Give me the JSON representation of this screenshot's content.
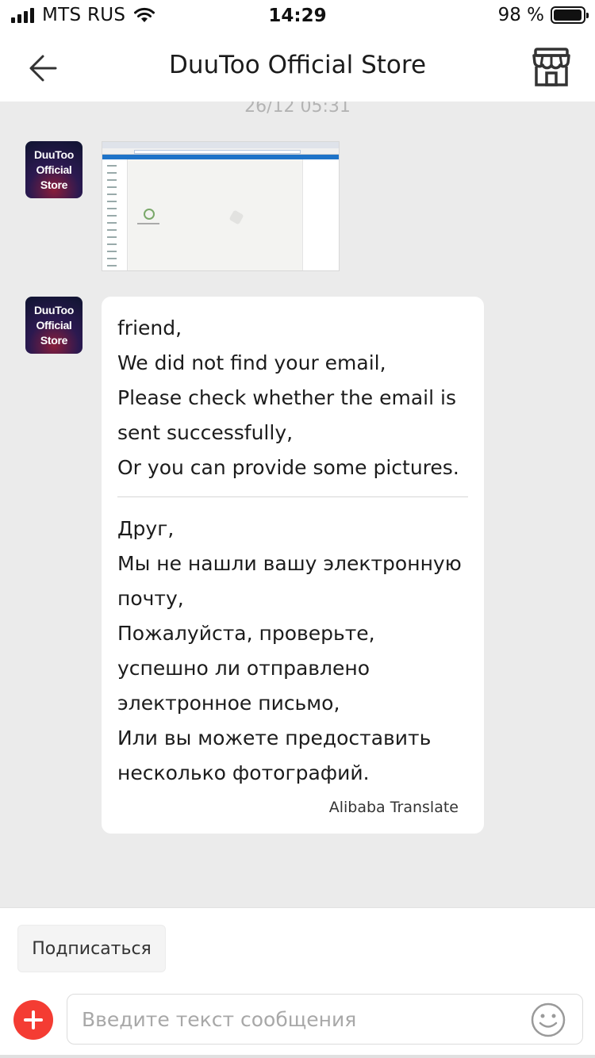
{
  "status_bar": {
    "carrier": "MTS RUS",
    "time": "14:29",
    "battery_percent": "98 %",
    "battery_level": 0.98
  },
  "header": {
    "title": "DuuToo Official Store",
    "back_icon": "arrow-left-icon",
    "store_icon": "storefront-icon"
  },
  "chat": {
    "timestamp": "26/12 05:31",
    "avatar_text": "DuuToo\nOfficial\nStore",
    "messages": [
      {
        "type": "image",
        "content": "screenshot"
      },
      {
        "type": "text",
        "original": "friend,\nWe did not find your email,\nPlease check whether the email is sent successfully,\nOr you can provide some pictures.",
        "translation": "Друг,\nМы не нашли вашу электронную почту,\nПожалуйста, проверьте, успешно ли отправлено электронное письмо,\nИли вы можете предоставить несколько фотографий.",
        "translator": "Alibaba Translate"
      }
    ]
  },
  "bottom": {
    "subscribe_label": "Подписаться",
    "input_placeholder": "Введите текст сообщения",
    "plus_icon": "plus-circle-icon",
    "emoji_icon": "smiley-icon"
  },
  "colors": {
    "accent_red": "#f43c33",
    "chat_background": "#ebebeb"
  }
}
